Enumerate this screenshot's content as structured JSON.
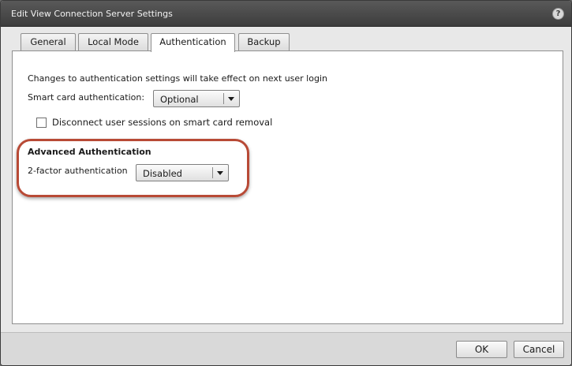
{
  "window": {
    "title": "Edit View Connection Server Settings",
    "help_icon": "help-icon",
    "help_glyph": "?"
  },
  "tabs": [
    {
      "label": "General",
      "active": false
    },
    {
      "label": "Local Mode",
      "active": false
    },
    {
      "label": "Authentication",
      "active": true
    },
    {
      "label": "Backup",
      "active": false
    }
  ],
  "authentication": {
    "notice": "Changes to authentication settings will take effect on next user login",
    "smart_card_label": "Smart card authentication:",
    "smart_card_value": "Optional",
    "disconnect_checkbox_label": "Disconnect user sessions on smart card removal",
    "disconnect_checked": false,
    "advanced_heading": "Advanced Authentication",
    "two_factor_label": "2-factor authentication",
    "two_factor_value": "Disabled"
  },
  "footer": {
    "ok_label": "OK",
    "cancel_label": "Cancel"
  },
  "colors": {
    "highlight_ring": "#b84a36",
    "titlebar": "#4a4a4a"
  }
}
